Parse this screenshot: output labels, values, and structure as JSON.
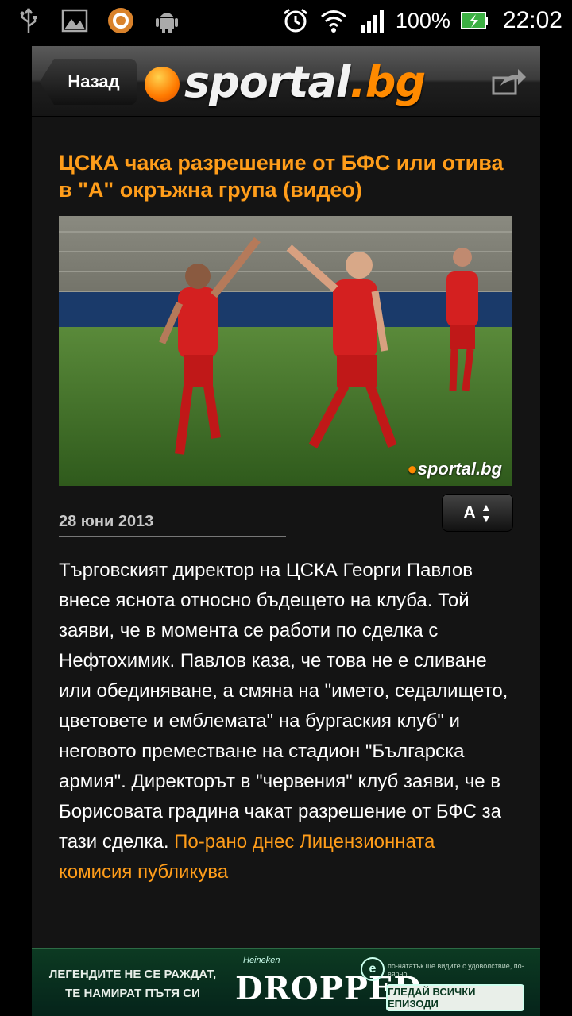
{
  "status_bar": {
    "battery": "100%",
    "time": "22:02",
    "icons": [
      "usb-icon",
      "gallery-icon",
      "app-notification-icon",
      "android-icon",
      "alarm-icon",
      "wifi-icon",
      "signal-icon",
      "battery-charging-icon"
    ]
  },
  "header": {
    "back_label": "Назад",
    "logo_word": "sportal",
    "logo_tld": ".bg",
    "share_icon": "share-icon"
  },
  "article": {
    "title": "ЦСКА чака разрешение от БФС или отива в \"А\" окръжна група (видео)",
    "photo_watermark": "sportal",
    "photo_watermark_tld": "bg",
    "date": "28 юни 2013",
    "font_button_label": "A",
    "body": "Търговският директор на ЦСКА Георги Павлов внесе яснота относно бъдещето на клуба. Той заяви, че в момента се работи по сделка с Нефтохимик. Павлов каза, че това не е сливане или обединяване, а смяна на \"името, седалището, цветовете и емблемата\" на бургаския клуб\" и неговото преместване на стадион \"Българска армия\". Директорът в \"червения\" клуб заяви, че в Борисовата градина чакат разрешение от БФС за тази сделка.",
    "link_text": "По-рано днес Лицензионната комисия публикува"
  },
  "ad": {
    "slogan_line1": "ЛЕГЕНДИТЕ НЕ СЕ РАЖДАТ,",
    "slogan_line2": "ТЕ НАМИРАТ ПЪТЯ СИ",
    "brand_small": "Heineken",
    "title": "DROPPED",
    "small_text": "по-нататък ще видите с удоволствие, по-вярно",
    "cta": "ГЛЕДАЙ ВСИЧКИ ЕПИЗОДИ"
  },
  "colors": {
    "accent": "#ff9d1a",
    "background": "#141414",
    "ad_green": "#0c3a22"
  }
}
